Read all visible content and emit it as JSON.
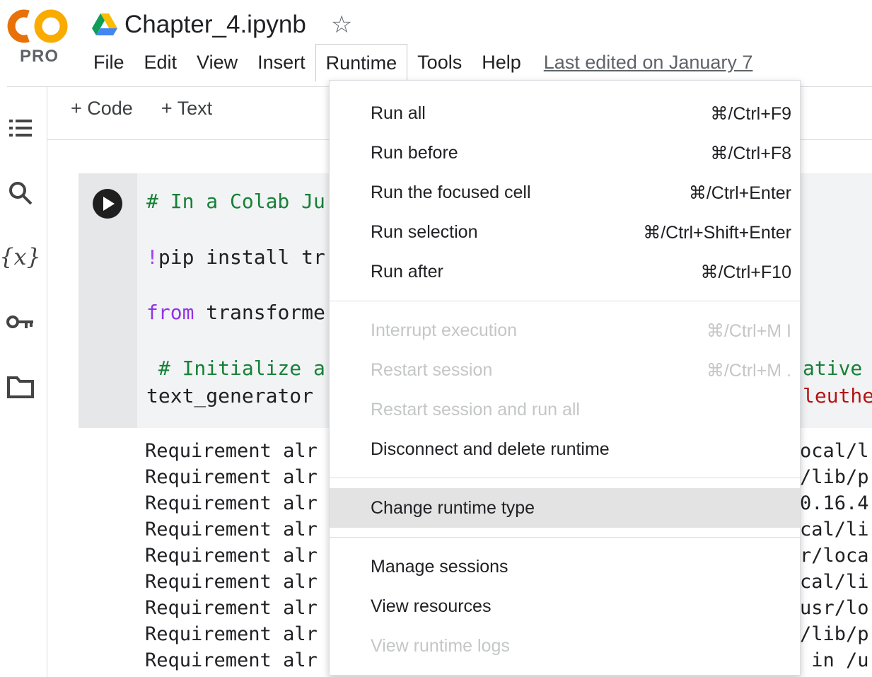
{
  "app": {
    "logo_text": "CO",
    "plan_badge": "PRO",
    "file_name": "Chapter_4.ipynb"
  },
  "menubar": {
    "items": [
      "File",
      "Edit",
      "View",
      "Insert",
      "Runtime",
      "Tools",
      "Help"
    ],
    "last_edited": "Last edited on January 7"
  },
  "toolbar": {
    "add_code": "+ Code",
    "add_text": "+ Text"
  },
  "sidebar": {
    "icons": [
      "toc-icon",
      "search-icon",
      "variables-icon",
      "secrets-key-icon",
      "folder-icon"
    ],
    "variables_glyph": "{x}"
  },
  "cell": {
    "line1": "# In a Colab Ju",
    "line2_bang": "!",
    "line2_rest": "pip install tr",
    "line3_kw": "from",
    "line3_rest": " transforme",
    "line4": " # Initialize a",
    "line5": "text_generator",
    "right1": "ative",
    "right2": "leuthe"
  },
  "output": {
    "left_text": "Requirement alr",
    "right_fragments": [
      "ocal/l",
      "/lib/p",
      "0.16.4",
      "cal/li",
      "r/loca",
      "cal/li",
      "usr/lo",
      "/lib/p",
      " in /u"
    ]
  },
  "runtime_menu": {
    "items": [
      {
        "label": "Run all",
        "shortcut": "⌘/Ctrl+F9",
        "disabled": false
      },
      {
        "label": "Run before",
        "shortcut": "⌘/Ctrl+F8",
        "disabled": false
      },
      {
        "label": "Run the focused cell",
        "shortcut": "⌘/Ctrl+Enter",
        "disabled": false
      },
      {
        "label": "Run selection",
        "shortcut": "⌘/Ctrl+Shift+Enter",
        "disabled": false
      },
      {
        "label": "Run after",
        "shortcut": "⌘/Ctrl+F10",
        "disabled": false
      },
      {
        "label": "Interrupt execution",
        "shortcut": "⌘/Ctrl+M I",
        "disabled": true
      },
      {
        "label": "Restart session",
        "shortcut": "⌘/Ctrl+M .",
        "disabled": true
      },
      {
        "label": "Restart session and run all",
        "shortcut": "",
        "disabled": true
      },
      {
        "label": "Disconnect and delete runtime",
        "shortcut": "",
        "disabled": false
      },
      {
        "label": "Change runtime type",
        "shortcut": "",
        "disabled": false,
        "highlighted": true
      },
      {
        "label": "Manage sessions",
        "shortcut": "",
        "disabled": false
      },
      {
        "label": "View resources",
        "shortcut": "",
        "disabled": false
      },
      {
        "label": "View runtime logs",
        "shortcut": "",
        "disabled": true
      }
    ]
  },
  "colors": {
    "logo_orange": "#f9ab00",
    "logo_orange_dark": "#e8710a",
    "comment_green": "#188038",
    "keyword_purple": "#9334e6",
    "highlight_gray": "#e3e3e3"
  }
}
